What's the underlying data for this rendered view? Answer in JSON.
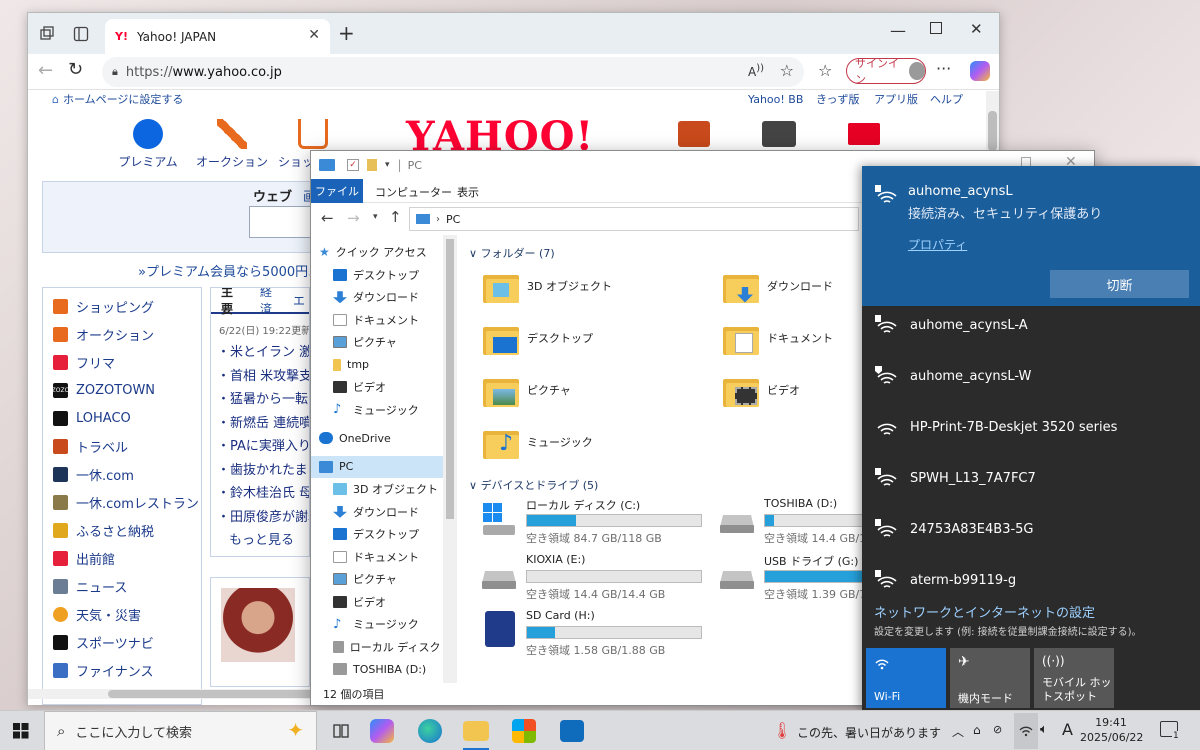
{
  "browser": {
    "tab_title": "Yahoo! JAPAN",
    "tab_favicon": "Y!",
    "url_prefix": "https://",
    "url_host": "www.yahoo.co.jp",
    "signin_label": "サインイン"
  },
  "yahoo": {
    "set_homepage": "ホームページに設定する",
    "top_links": [
      "Yahoo! BB",
      "きっず版",
      "アプリ版",
      "ヘルプ"
    ],
    "logo": "YAHOO!",
    "services": [
      "プレミアム",
      "オークション",
      "ショッ"
    ],
    "search_tab": "ウェブ",
    "search_tab_next": "画",
    "premium_promo": "»プレミアム会員なら5000円以",
    "left_nav": [
      "ショッピング",
      "オークション",
      "フリマ",
      "ZOZOTOWN",
      "LOHACO",
      "トラベル",
      "一休.com",
      "一休.comレストラン",
      "ふるさと納税",
      "出前館",
      "ニュース",
      "天気・災害",
      "スポーツナビ",
      "ファイナンス"
    ],
    "left_nav_zozo_icon": "ZOZO",
    "news_tabs": [
      "主要",
      "経済",
      "エ"
    ],
    "news_date": "6/22(日) 19:22更新",
    "news_items": [
      "・米とイラン 激",
      "・首相 米攻撃支",
      "・猛暑から一転ご",
      "・新燃岳 連続噴",
      "・PAに実弾入り",
      "・歯抜かれたまま",
      "・鈴木桂治氏 母",
      "・田原俊彦が謝罪"
    ],
    "news_more": "もっと見る"
  },
  "explorer": {
    "title": "PC",
    "ribbon_tabs": [
      "ファイル",
      "コンピューター",
      "表示"
    ],
    "path": "PC",
    "quick_access": "クイック アクセス",
    "nav_quick": [
      "デスクトップ",
      "ダウンロード",
      "ドキュメント",
      "ピクチャ",
      "tmp",
      "ビデオ",
      "ミュージック"
    ],
    "onedrive": "OneDrive",
    "pc": "PC",
    "nav_pc": [
      "3D オブジェクト",
      "ダウンロード",
      "デスクトップ",
      "ドキュメント",
      "ピクチャ",
      "ビデオ",
      "ミュージック",
      "ローカル ディスク (C",
      "TOSHIBA (D:)"
    ],
    "folders_header": "フォルダー (7)",
    "folders": [
      "3D オブジェクト",
      "ダウンロード",
      "デスクトップ",
      "ドキュメント",
      "ピクチャ",
      "ビデオ",
      "ミュージック"
    ],
    "drives_header": "デバイスとドライブ (5)",
    "drives": [
      {
        "name": "ローカル ディスク (C:)",
        "free": "空き領域 84.7 GB/118 GB",
        "used": 0.28
      },
      {
        "name": "TOSHIBA (D:)",
        "free": "空き領域 14.4 GB/14",
        "used": 0.05
      },
      {
        "name": "KIOXIA (E:)",
        "free": "空き領域 14.4 GB/14.4 GB",
        "used": 0.0
      },
      {
        "name": "USB ドライブ (G:)",
        "free": "空き領域 1.39 GB/7.",
        "used": 0.82
      },
      {
        "name": "SD Card (H:)",
        "free": "空き領域 1.58 GB/1.88 GB",
        "used": 0.16
      }
    ],
    "item_count": "12 個の項目"
  },
  "wifi": {
    "connected": {
      "ssid": "auhome_acynsL",
      "status": "接続済み、セキュリティ保護あり",
      "properties": "プロパティ",
      "disconnect": "切断"
    },
    "networks": [
      "auhome_acynsL-A",
      "auhome_acynsL-W",
      "HP-Print-7B-Deskjet 3520 series",
      "SPWH_L13_7A7FC7",
      "24753A83E4B3-5G",
      "aterm-b99119-g"
    ],
    "settings_title": "ネットワークとインターネットの設定",
    "settings_desc": "設定を変更します (例: 接続を従量制課金接続に設定する)。",
    "quick": [
      "Wi-Fi",
      "機内モード",
      "モバイル ホットスポット"
    ]
  },
  "taskbar": {
    "search_placeholder": "ここに入力して検索",
    "weather": "この先、暑い日があります",
    "ime": "A",
    "time": "19:41",
    "date": "2025/06/22",
    "notif_count": "1"
  },
  "colors": {
    "accent": "#1b5e9c",
    "yahoo_red": "#ff0033",
    "explorer_blue": "#1a63b8"
  }
}
